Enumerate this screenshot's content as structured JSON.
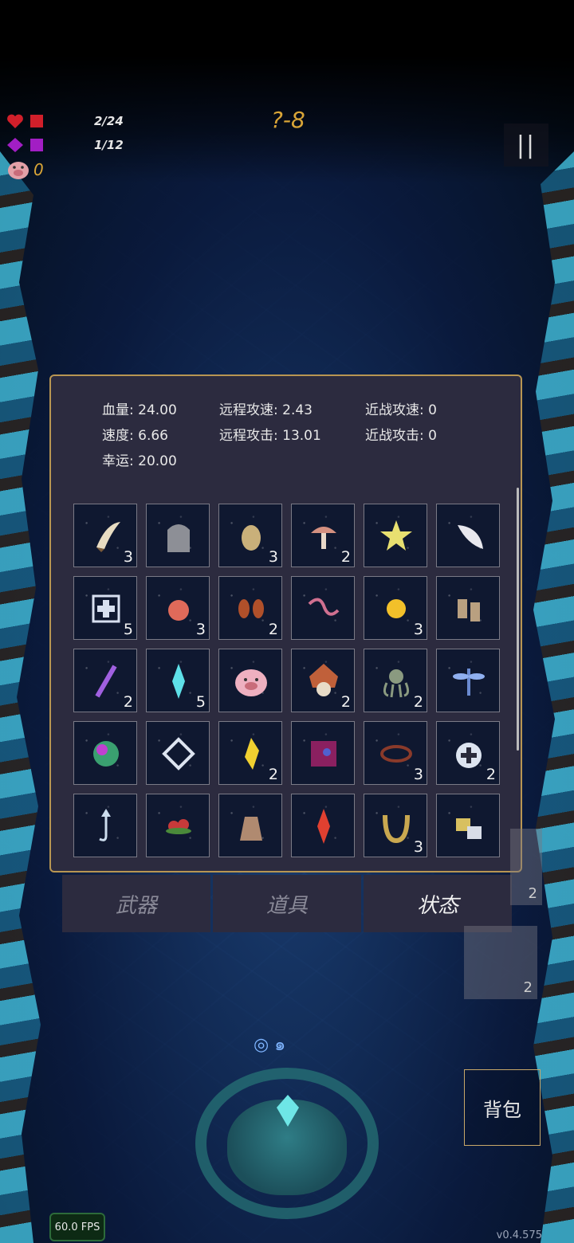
{
  "hud": {
    "hp_text": "2/24",
    "mana_text": "1/12",
    "coin_count": "0",
    "level": "?-8",
    "pause_icon": "pause-icon",
    "colors": {
      "hp": "#d11f2a",
      "mana": "#a21ec4",
      "coin": "#d9a537"
    }
  },
  "stats": {
    "hp_label": "血量:",
    "hp_value": "24.00",
    "speed_label": "速度:",
    "speed_value": "6.66",
    "luck_label": "幸运:",
    "luck_value": "20.00",
    "ranged_speed_label": "远程攻速:",
    "ranged_speed_value": "2.43",
    "ranged_attack_label": "远程攻击:",
    "ranged_attack_value": "13.01",
    "melee_speed_label": "近战攻速:",
    "melee_speed_value": "0",
    "melee_attack_label": "近战攻击:",
    "melee_attack_value": "0"
  },
  "items": [
    {
      "icon": "fang-icon",
      "count": "3"
    },
    {
      "icon": "tombstone-icon",
      "count": ""
    },
    {
      "icon": "egg-icon",
      "count": "3"
    },
    {
      "icon": "mushroom-icon",
      "count": "2"
    },
    {
      "icon": "star-icon",
      "count": ""
    },
    {
      "icon": "feather-icon",
      "count": ""
    },
    {
      "icon": "first-aid-icon",
      "count": "5"
    },
    {
      "icon": "apple-icon",
      "count": "3"
    },
    {
      "icon": "kidneys-icon",
      "count": "2"
    },
    {
      "icon": "worm-icon",
      "count": ""
    },
    {
      "icon": "sun-orb-icon",
      "count": "3"
    },
    {
      "icon": "boots-icon",
      "count": ""
    },
    {
      "icon": "wand-icon",
      "count": "2"
    },
    {
      "icon": "crystal-shard-icon",
      "count": "5"
    },
    {
      "icon": "piggy-bank-icon",
      "count": ""
    },
    {
      "icon": "tribal-mask-icon",
      "count": "2"
    },
    {
      "icon": "octopus-icon",
      "count": "2"
    },
    {
      "icon": "dragonfly-icon",
      "count": ""
    },
    {
      "icon": "rainbow-orb-icon",
      "count": ""
    },
    {
      "icon": "diamond-tile-icon",
      "count": ""
    },
    {
      "icon": "yellow-gem-icon",
      "count": "2"
    },
    {
      "icon": "spellbook-icon",
      "count": ""
    },
    {
      "icon": "thorn-crown-icon",
      "count": "3"
    },
    {
      "icon": "medal-ring-icon",
      "count": "2"
    },
    {
      "icon": "hook-icon",
      "count": ""
    },
    {
      "icon": "berries-icon",
      "count": ""
    },
    {
      "icon": "sack-icon",
      "count": ""
    },
    {
      "icon": "red-crystal-icon",
      "count": ""
    },
    {
      "icon": "horseshoe-icon",
      "count": "3"
    },
    {
      "icon": "ore-chunks-icon",
      "count": ""
    }
  ],
  "tabs": {
    "weapons": "武器",
    "props": "道具",
    "status": "状态",
    "active": "status"
  },
  "ghost_cards": {
    "count1": "2",
    "count2": "2"
  },
  "bag_label": "背包",
  "fps": "60.0 FPS",
  "version": "v0.4.575"
}
